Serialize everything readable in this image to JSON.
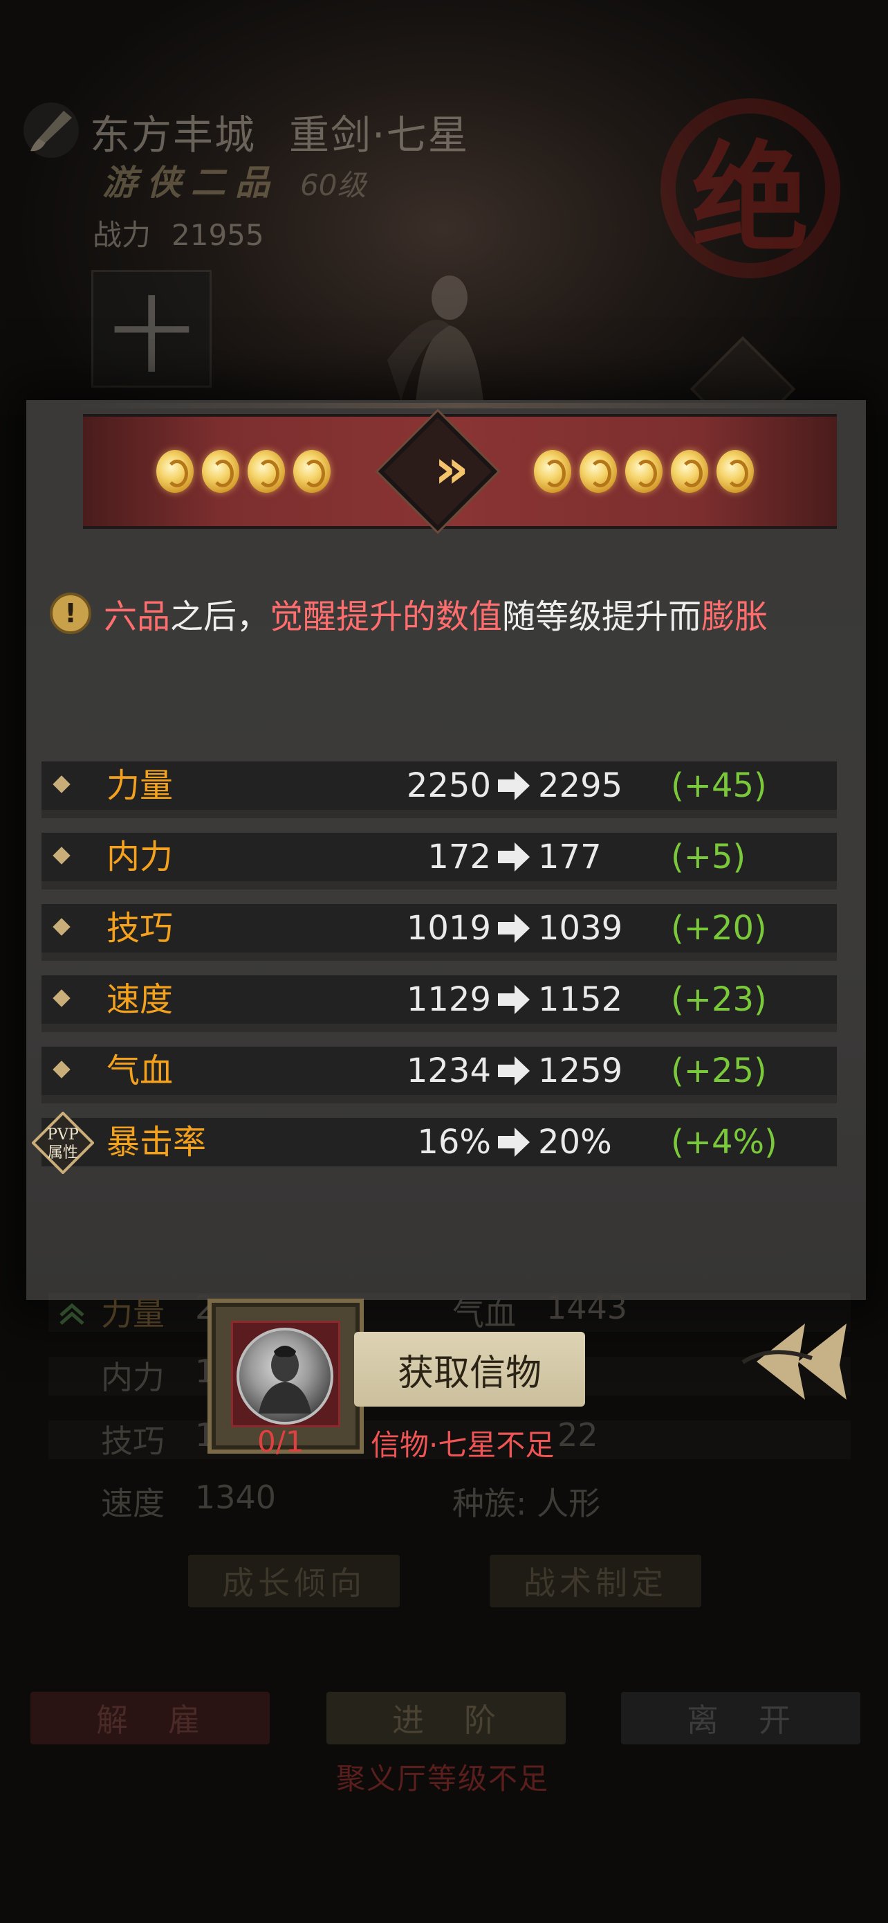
{
  "header": {
    "city": "东方丰城",
    "character_name": "重剑·七星",
    "rank": "游侠二品",
    "level": "60级",
    "power_label": "战力",
    "power_value": "21955",
    "seal_char": "绝",
    "plus_glyph": "十"
  },
  "awaken": {
    "stars_before": 4,
    "stars_after": 5,
    "arrow_glyph": "»",
    "notice_parts": [
      "六品",
      "之后，",
      "觉醒提升的数值",
      "随等级提升而",
      "膨胀"
    ]
  },
  "stats": [
    {
      "name": "力量",
      "current": "2250",
      "next": "2295",
      "diff": "(+45)",
      "icon": "diamond-bullet"
    },
    {
      "name": "内力",
      "current": "172",
      "next": "177",
      "diff": "(+5)",
      "icon": "diamond-bullet"
    },
    {
      "name": "技巧",
      "current": "1019",
      "next": "1039",
      "diff": "(+20)",
      "icon": "diamond-bullet"
    },
    {
      "name": "速度",
      "current": "1129",
      "next": "1152",
      "diff": "(+23)",
      "icon": "diamond-bullet"
    },
    {
      "name": "气血",
      "current": "1234",
      "next": "1259",
      "diff": "(+25)",
      "icon": "diamond-bullet"
    },
    {
      "name": "暴击率",
      "current": "16%",
      "next": "20%",
      "diff": "(+4%)",
      "icon": "pvp-badge"
    }
  ],
  "pvp_badge": {
    "line1": "PVP",
    "line2": "属性"
  },
  "background_attrs": {
    "strength_label": "力量",
    "strength_partial": "2",
    "inner_label": "内力",
    "inner_partial": "1",
    "skill_label": "技巧",
    "skill_partial": "1",
    "speed_label": "速度",
    "speed_value": "1340",
    "hp_label": "气血",
    "hp_value": "1443",
    "third_right_partial": "22",
    "race_label": "种族: 人形",
    "growth_button": "成长倾向",
    "tactics_button": "战术制定"
  },
  "token": {
    "count": "0/1",
    "button_label": "获取信物",
    "lack_message": "信物·七星不足"
  },
  "bottom_buttons": {
    "dismiss": "解　雇",
    "advance": "进　阶",
    "leave": "离　开",
    "requirement": "聚义厅等级不足"
  },
  "colors": {
    "accent_gold": "#f4a21d",
    "diff_green": "#7ac93b",
    "warning_red": "#ff6e6e",
    "banner_red": "#8a3434"
  }
}
